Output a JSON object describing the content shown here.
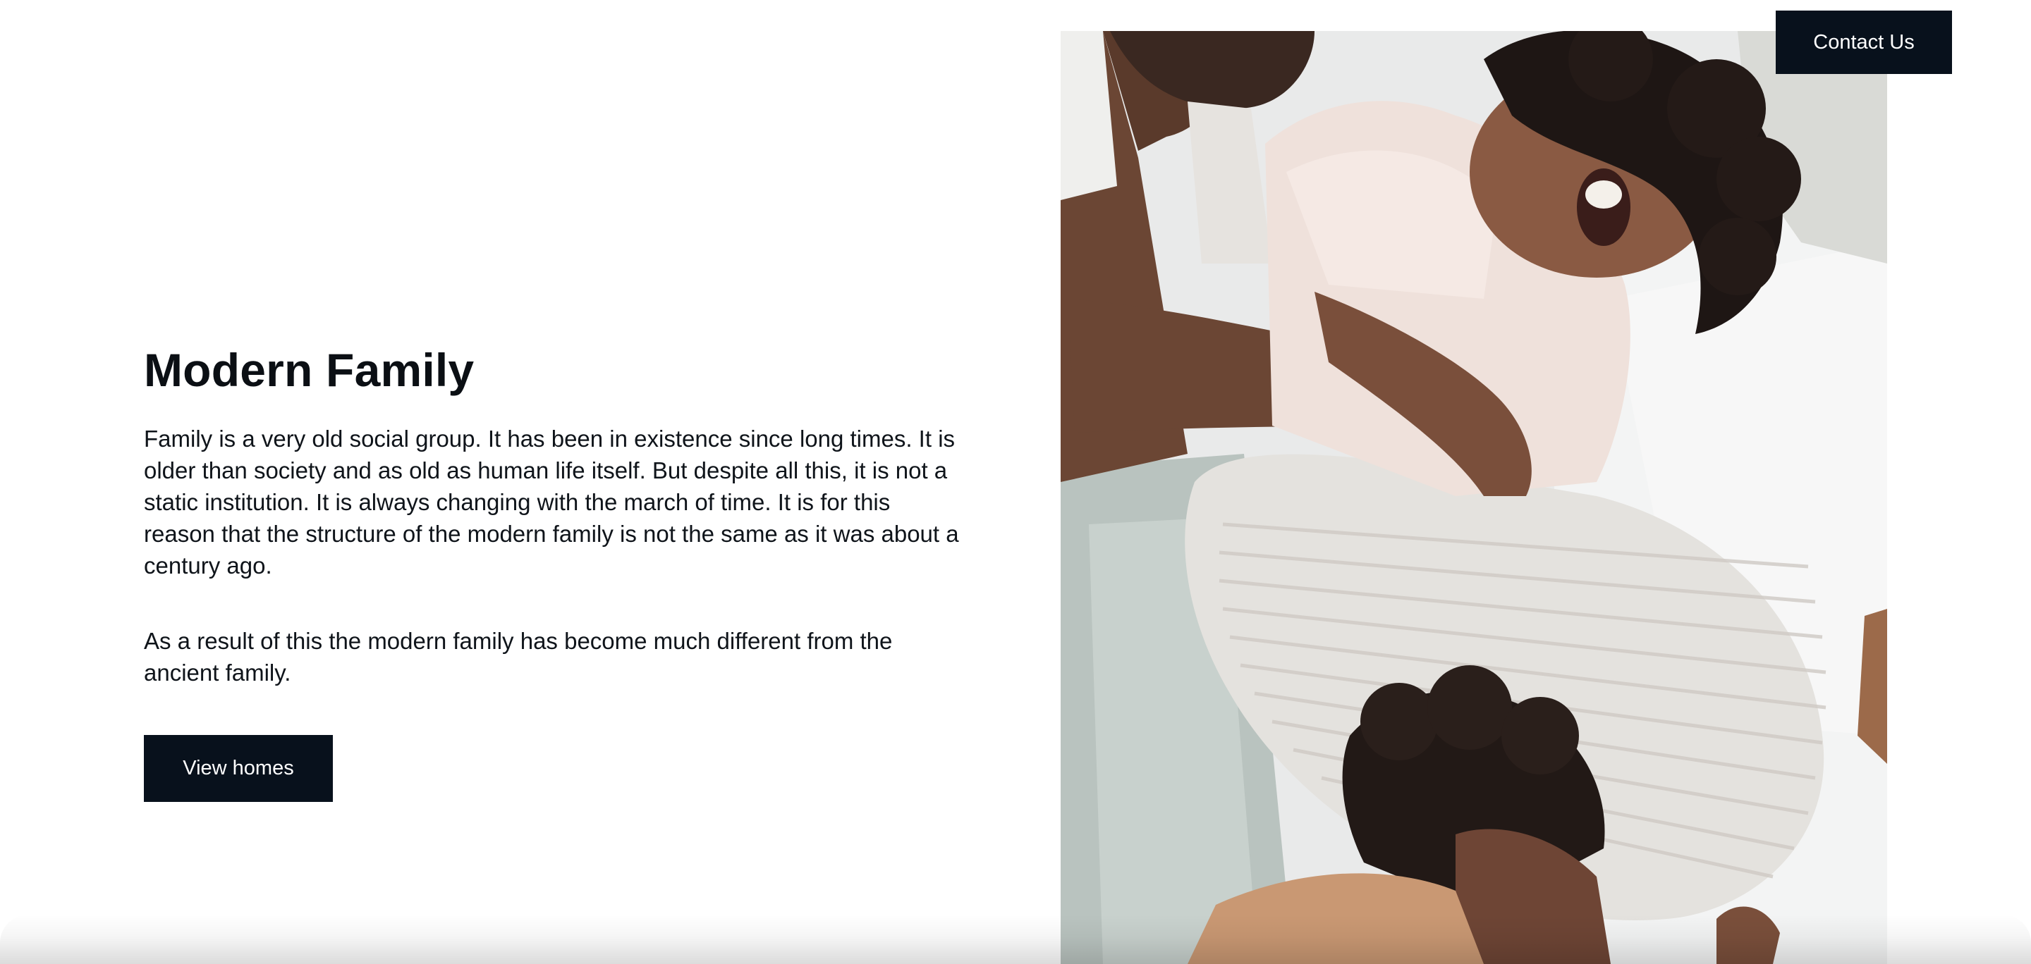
{
  "header": {
    "contact_label": "Contact Us"
  },
  "hero": {
    "title": "Modern Family",
    "paragraph_1": "Family is a very old social group. It has been in existence since long times. It is older than society and as old as human life itself. But despite all this, it is not a static institution. It is always changing with the march of time. It is for this reason that the structure of the modern family is not the same as it was about a century ago.",
    "paragraph_2": "As a result of this the modern family has become much different from the ancient family.",
    "cta_label": "View homes"
  },
  "colors": {
    "button_bg": "#08111c",
    "text": "#0b0f14",
    "background": "#ffffff"
  }
}
